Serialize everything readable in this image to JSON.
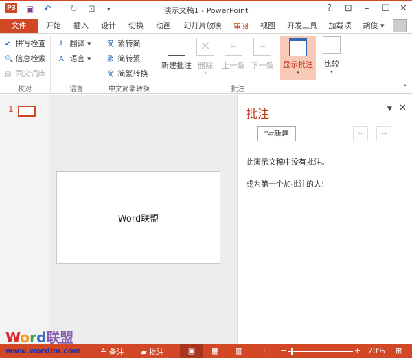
{
  "window": {
    "title": "演示文稿1 - PowerPoint",
    "help": "?",
    "minimize": "–",
    "maximize": "☐",
    "close": "✕",
    "ribbon_display": "⊡"
  },
  "qat": {
    "app_icon": "P3",
    "save": "💾",
    "undo": "↶",
    "redo": "↻",
    "present": "⊡",
    "customize": "▾"
  },
  "tabs": [
    "文件",
    "开始",
    "插入",
    "设计",
    "切换",
    "动画",
    "幻灯片放映",
    "审阅",
    "视图",
    "开发工具",
    "加载项"
  ],
  "user": {
    "name": "胡俊"
  },
  "ribbon": {
    "proofing": {
      "label": "校对",
      "items": [
        "拼写检查",
        "信息检索",
        "同义词库"
      ]
    },
    "language": {
      "label": "语言",
      "items": [
        "翻译",
        "语言"
      ]
    },
    "chinese": {
      "label": "中文简繁转换",
      "items": [
        "繁转简",
        "简转繁",
        "简繁转换"
      ]
    },
    "comments": {
      "label": "批注",
      "items": [
        "新建批注",
        "删除",
        "上一条",
        "下一条",
        "显示批注"
      ]
    },
    "compare": {
      "label": "比较"
    }
  },
  "thumbs": {
    "slide_number": "1"
  },
  "slide": {
    "text": "Word联盟"
  },
  "pane": {
    "title": "批注",
    "new_button": "新建",
    "empty_message": "此演示文稿中没有批注。",
    "prompt": "成为第一个加批注的人!"
  },
  "watermark": {
    "brand": "Word联盟",
    "url": "www.wordlm.com"
  },
  "status": {
    "notes": "备注",
    "comments": "批注",
    "zoom": "20%",
    "zoom_value": 20
  },
  "colors": {
    "accent": "#d24726",
    "active_bg": "#f8c9b6"
  }
}
